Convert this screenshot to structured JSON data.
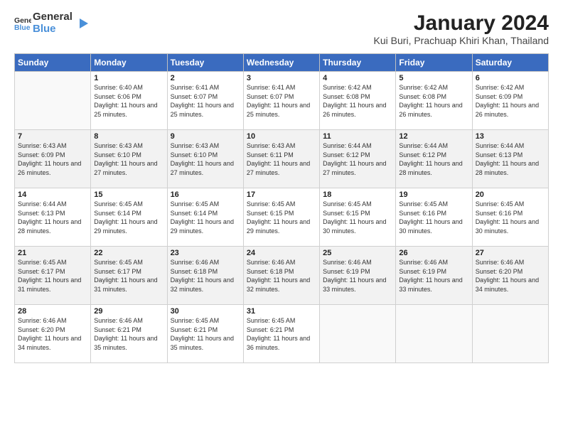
{
  "logo": {
    "general": "General",
    "blue": "Blue"
  },
  "header": {
    "month": "January 2024",
    "location": "Kui Buri, Prachuap Khiri Khan, Thailand"
  },
  "weekdays": [
    "Sunday",
    "Monday",
    "Tuesday",
    "Wednesday",
    "Thursday",
    "Friday",
    "Saturday"
  ],
  "weeks": [
    [
      {
        "day": "",
        "sunrise": "",
        "sunset": "",
        "daylight": ""
      },
      {
        "day": "1",
        "sunrise": "Sunrise: 6:40 AM",
        "sunset": "Sunset: 6:06 PM",
        "daylight": "Daylight: 11 hours and 25 minutes."
      },
      {
        "day": "2",
        "sunrise": "Sunrise: 6:41 AM",
        "sunset": "Sunset: 6:07 PM",
        "daylight": "Daylight: 11 hours and 25 minutes."
      },
      {
        "day": "3",
        "sunrise": "Sunrise: 6:41 AM",
        "sunset": "Sunset: 6:07 PM",
        "daylight": "Daylight: 11 hours and 25 minutes."
      },
      {
        "day": "4",
        "sunrise": "Sunrise: 6:42 AM",
        "sunset": "Sunset: 6:08 PM",
        "daylight": "Daylight: 11 hours and 26 minutes."
      },
      {
        "day": "5",
        "sunrise": "Sunrise: 6:42 AM",
        "sunset": "Sunset: 6:08 PM",
        "daylight": "Daylight: 11 hours and 26 minutes."
      },
      {
        "day": "6",
        "sunrise": "Sunrise: 6:42 AM",
        "sunset": "Sunset: 6:09 PM",
        "daylight": "Daylight: 11 hours and 26 minutes."
      }
    ],
    [
      {
        "day": "7",
        "sunrise": "Sunrise: 6:43 AM",
        "sunset": "Sunset: 6:09 PM",
        "daylight": "Daylight: 11 hours and 26 minutes."
      },
      {
        "day": "8",
        "sunrise": "Sunrise: 6:43 AM",
        "sunset": "Sunset: 6:10 PM",
        "daylight": "Daylight: 11 hours and 27 minutes."
      },
      {
        "day": "9",
        "sunrise": "Sunrise: 6:43 AM",
        "sunset": "Sunset: 6:10 PM",
        "daylight": "Daylight: 11 hours and 27 minutes."
      },
      {
        "day": "10",
        "sunrise": "Sunrise: 6:43 AM",
        "sunset": "Sunset: 6:11 PM",
        "daylight": "Daylight: 11 hours and 27 minutes."
      },
      {
        "day": "11",
        "sunrise": "Sunrise: 6:44 AM",
        "sunset": "Sunset: 6:12 PM",
        "daylight": "Daylight: 11 hours and 27 minutes."
      },
      {
        "day": "12",
        "sunrise": "Sunrise: 6:44 AM",
        "sunset": "Sunset: 6:12 PM",
        "daylight": "Daylight: 11 hours and 28 minutes."
      },
      {
        "day": "13",
        "sunrise": "Sunrise: 6:44 AM",
        "sunset": "Sunset: 6:13 PM",
        "daylight": "Daylight: 11 hours and 28 minutes."
      }
    ],
    [
      {
        "day": "14",
        "sunrise": "Sunrise: 6:44 AM",
        "sunset": "Sunset: 6:13 PM",
        "daylight": "Daylight: 11 hours and 28 minutes."
      },
      {
        "day": "15",
        "sunrise": "Sunrise: 6:45 AM",
        "sunset": "Sunset: 6:14 PM",
        "daylight": "Daylight: 11 hours and 29 minutes."
      },
      {
        "day": "16",
        "sunrise": "Sunrise: 6:45 AM",
        "sunset": "Sunset: 6:14 PM",
        "daylight": "Daylight: 11 hours and 29 minutes."
      },
      {
        "day": "17",
        "sunrise": "Sunrise: 6:45 AM",
        "sunset": "Sunset: 6:15 PM",
        "daylight": "Daylight: 11 hours and 29 minutes."
      },
      {
        "day": "18",
        "sunrise": "Sunrise: 6:45 AM",
        "sunset": "Sunset: 6:15 PM",
        "daylight": "Daylight: 11 hours and 30 minutes."
      },
      {
        "day": "19",
        "sunrise": "Sunrise: 6:45 AM",
        "sunset": "Sunset: 6:16 PM",
        "daylight": "Daylight: 11 hours and 30 minutes."
      },
      {
        "day": "20",
        "sunrise": "Sunrise: 6:45 AM",
        "sunset": "Sunset: 6:16 PM",
        "daylight": "Daylight: 11 hours and 30 minutes."
      }
    ],
    [
      {
        "day": "21",
        "sunrise": "Sunrise: 6:45 AM",
        "sunset": "Sunset: 6:17 PM",
        "daylight": "Daylight: 11 hours and 31 minutes."
      },
      {
        "day": "22",
        "sunrise": "Sunrise: 6:45 AM",
        "sunset": "Sunset: 6:17 PM",
        "daylight": "Daylight: 11 hours and 31 minutes."
      },
      {
        "day": "23",
        "sunrise": "Sunrise: 6:46 AM",
        "sunset": "Sunset: 6:18 PM",
        "daylight": "Daylight: 11 hours and 32 minutes."
      },
      {
        "day": "24",
        "sunrise": "Sunrise: 6:46 AM",
        "sunset": "Sunset: 6:18 PM",
        "daylight": "Daylight: 11 hours and 32 minutes."
      },
      {
        "day": "25",
        "sunrise": "Sunrise: 6:46 AM",
        "sunset": "Sunset: 6:19 PM",
        "daylight": "Daylight: 11 hours and 33 minutes."
      },
      {
        "day": "26",
        "sunrise": "Sunrise: 6:46 AM",
        "sunset": "Sunset: 6:19 PM",
        "daylight": "Daylight: 11 hours and 33 minutes."
      },
      {
        "day": "27",
        "sunrise": "Sunrise: 6:46 AM",
        "sunset": "Sunset: 6:20 PM",
        "daylight": "Daylight: 11 hours and 34 minutes."
      }
    ],
    [
      {
        "day": "28",
        "sunrise": "Sunrise: 6:46 AM",
        "sunset": "Sunset: 6:20 PM",
        "daylight": "Daylight: 11 hours and 34 minutes."
      },
      {
        "day": "29",
        "sunrise": "Sunrise: 6:46 AM",
        "sunset": "Sunset: 6:21 PM",
        "daylight": "Daylight: 11 hours and 35 minutes."
      },
      {
        "day": "30",
        "sunrise": "Sunrise: 6:45 AM",
        "sunset": "Sunset: 6:21 PM",
        "daylight": "Daylight: 11 hours and 35 minutes."
      },
      {
        "day": "31",
        "sunrise": "Sunrise: 6:45 AM",
        "sunset": "Sunset: 6:21 PM",
        "daylight": "Daylight: 11 hours and 36 minutes."
      },
      {
        "day": "",
        "sunrise": "",
        "sunset": "",
        "daylight": ""
      },
      {
        "day": "",
        "sunrise": "",
        "sunset": "",
        "daylight": ""
      },
      {
        "day": "",
        "sunrise": "",
        "sunset": "",
        "daylight": ""
      }
    ]
  ]
}
